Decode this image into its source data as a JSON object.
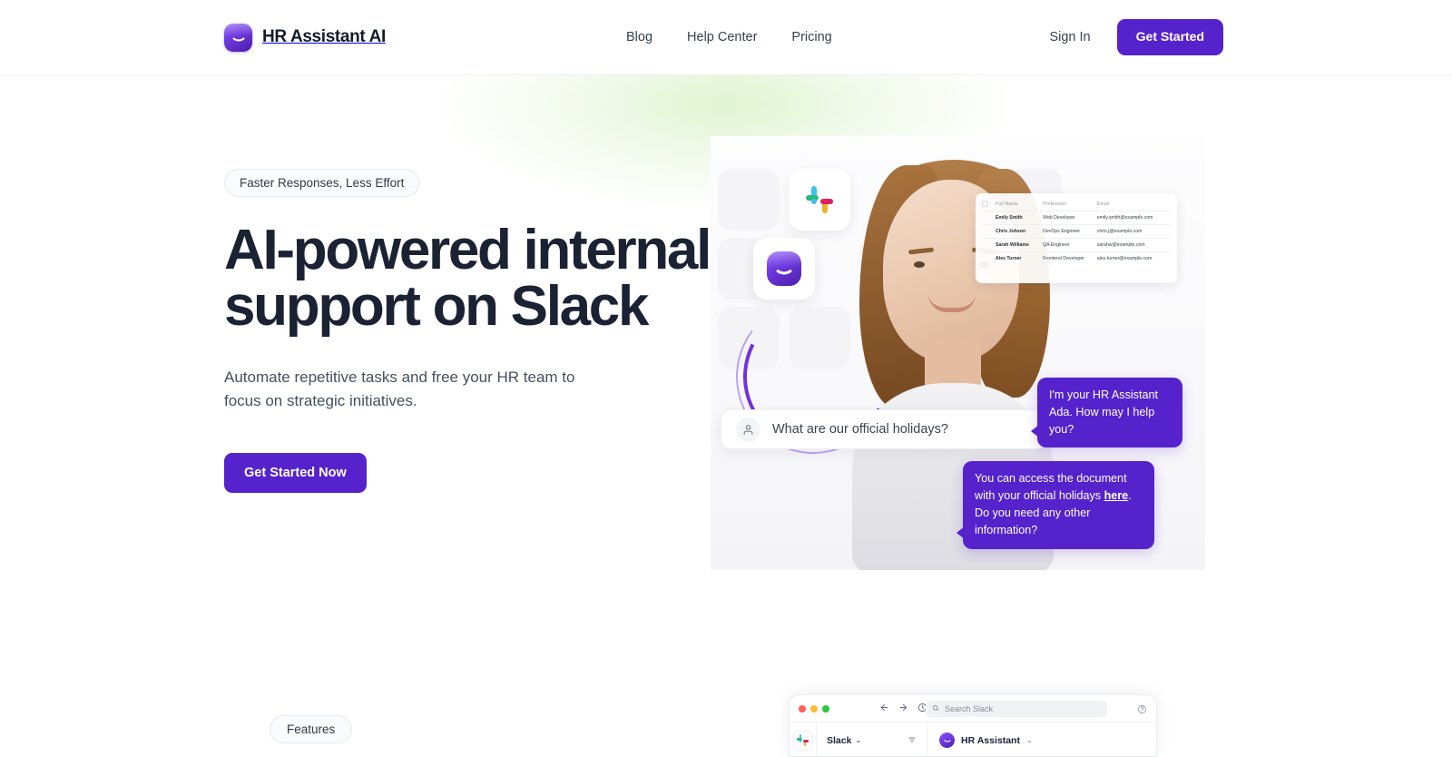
{
  "header": {
    "brand": {
      "name": "HR Assistant AI",
      "logo_icon": "hr-assistant-smile-icon"
    },
    "nav": [
      {
        "label": "Blog"
      },
      {
        "label": "Help Center"
      },
      {
        "label": "Pricing"
      }
    ],
    "sign_in_label": "Sign In",
    "get_started_label": "Get Started"
  },
  "hero": {
    "badge": "Faster Responses, Less Effort",
    "title": "AI-powered internal support on Slack",
    "subtitle": "Automate repetitive tasks and free your HR team to focus on strategic initiatives.",
    "cta_label": "Get Started Now"
  },
  "hero_visual": {
    "app_icons": [
      {
        "name": "slack-icon"
      },
      {
        "name": "hr-assistant-icon"
      }
    ],
    "employee_table": {
      "columns": [
        "Full Name",
        "Profession",
        "Email"
      ],
      "rows": [
        {
          "name": "Emily Smith",
          "profession": "Web Developer",
          "email": "emily.smith@example.com"
        },
        {
          "name": "Chris Johson",
          "profession": "DevOps Engineer",
          "email": "chris.j@example.com"
        },
        {
          "name": "Sarah Williams",
          "profession": "QA Engineer",
          "email": "sarahw@example.com"
        },
        {
          "name": "Alex Turner",
          "profession": "Frontend Developer",
          "email": "alex.turner@example.com"
        }
      ]
    },
    "question": {
      "avatar_icon": "user-icon",
      "text": "What are our official holidays?"
    },
    "messages": [
      {
        "text": "I'm your HR Assistant Ada. How may I help you?"
      },
      {
        "before": "You can access the document with your official holidays ",
        "link": "here",
        "after": ". Do you need any other information?"
      }
    ]
  },
  "features": {
    "badge": "Features"
  },
  "slack_mock": {
    "window_controls": [
      "close",
      "minimize",
      "maximize"
    ],
    "back_icon": "arrow-left-icon",
    "forward_icon": "arrow-right-icon",
    "history_icon": "clock-icon",
    "search_placeholder": "Search Slack",
    "help_icon": "help-circle-icon",
    "rail_icon": "slack-icon",
    "workspace": "Slack",
    "filter_icon": "filter-icon",
    "channel": "HR Assistant",
    "chevron": "⌄"
  },
  "colors": {
    "accent": "#5522CC",
    "accent_light": "#8B5CF6",
    "text_dark": "#1A2233",
    "text_muted": "#454F5F",
    "glow_green": "#C8ECAA"
  }
}
